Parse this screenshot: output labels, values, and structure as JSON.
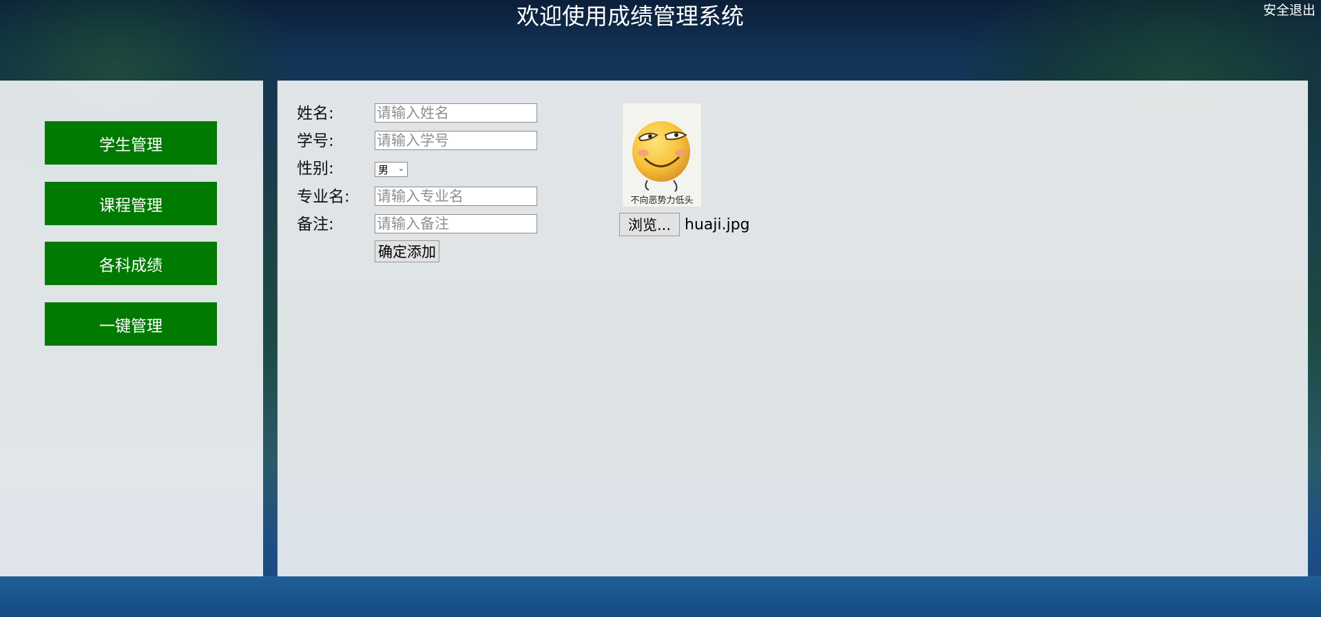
{
  "header": {
    "title": "欢迎使用成绩管理系统",
    "logout_label": "安全退出"
  },
  "sidebar": {
    "items": [
      {
        "label": "学生管理"
      },
      {
        "label": "课程管理"
      },
      {
        "label": "各科成绩"
      },
      {
        "label": "一键管理"
      }
    ],
    "button_color": "#007a00"
  },
  "form": {
    "name": {
      "label": "姓名:",
      "placeholder": "请输入姓名",
      "value": ""
    },
    "student_id": {
      "label": "学号:",
      "placeholder": "请输入学号",
      "value": ""
    },
    "gender": {
      "label": "性别:",
      "selected": "男"
    },
    "major": {
      "label": "专业名:",
      "placeholder": "请输入专业名",
      "value": ""
    },
    "remark": {
      "label": "备注:",
      "placeholder": "请输入备注",
      "value": ""
    },
    "submit_label": "确定添加"
  },
  "photo": {
    "caption": "不向恶势力低头",
    "icon": "smiley-face-icon",
    "browse_label": "浏览...",
    "file_name": "huaji.jpg"
  }
}
